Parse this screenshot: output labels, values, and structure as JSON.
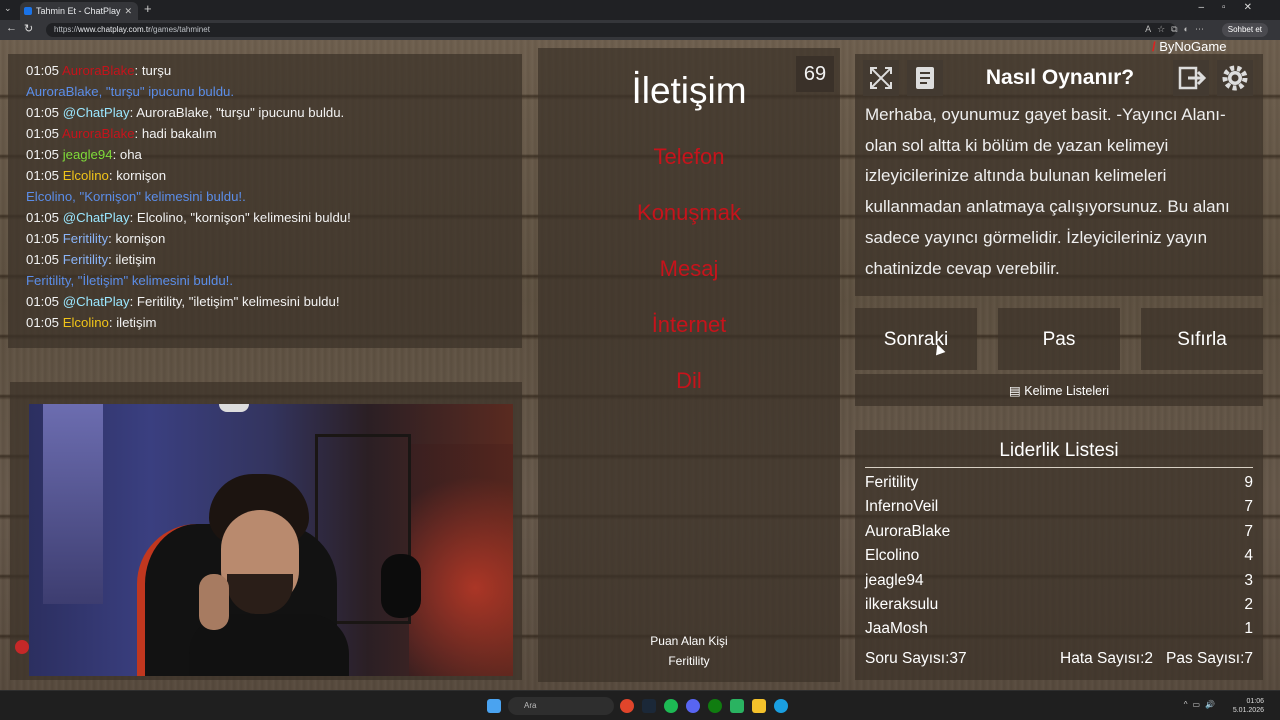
{
  "browser": {
    "tab_title": "Tahmin Et - ChatPlay",
    "url_prefix": "https://",
    "url_host": "www.chatplay.com.tr",
    "url_path": "/games/tahminet",
    "chat_button": "Sohbet et"
  },
  "chat": [
    {
      "ts": "01:05",
      "user": "AuroraBlake",
      "user_color": "#c6131b",
      "text": ": turşu"
    },
    {
      "system": "AuroraBlake, \"turşu\" ipucunu buldu."
    },
    {
      "ts": "01:05",
      "user": "@ChatPlay",
      "user_color": "#9be7ff",
      "text": ": AuroraBlake, \"turşu\" ipucunu buldu."
    },
    {
      "ts": "01:05",
      "user": "AuroraBlake",
      "user_color": "#c6131b",
      "text": ": hadi bakalım"
    },
    {
      "ts": "01:05",
      "user": "jeagle94",
      "user_color": "#7fdc3a",
      "text": ": oha"
    },
    {
      "ts": "01:05",
      "user": "Elcolino",
      "user_color": "#f0c419",
      "text": ": kornişon"
    },
    {
      "system": "Elcolino, \"Kornişon\" kelimesini buldu!."
    },
    {
      "ts": "01:05",
      "user": "@ChatPlay",
      "user_color": "#9be7ff",
      "text": ": Elcolino, \"kornişon\" kelimesini buldu!"
    },
    {
      "ts": "01:05",
      "user": "Feritility",
      "user_color": "#8ab4f8",
      "text": ": kornişon"
    },
    {
      "ts": "01:05",
      "user": "Feritility",
      "user_color": "#8ab4f8",
      "text": ": iletişim"
    },
    {
      "system": "Feritility, \"İletişim\" kelimesini buldu!."
    },
    {
      "ts": "01:05",
      "user": "@ChatPlay",
      "user_color": "#9be7ff",
      "text": ": Feritility, \"iletişim\" kelimesini buldu!"
    },
    {
      "ts": "01:05",
      "user": "Elcolino",
      "user_color": "#f0c419",
      "text": ": iletişim"
    }
  ],
  "card": {
    "timer": "69",
    "word": "İletişim",
    "forbidden": [
      "Telefon",
      "Konuşmak",
      "Mesaj",
      "İnternet",
      "Dil"
    ],
    "scorer_label": "Puan Alan Kişi",
    "scorer_name": "Feritility"
  },
  "howto": {
    "title": "Nasıl Oynanır?",
    "text": "Merhaba, oyunumuz gayet basit. -Yayıncı Alanı- olan sol altta ki bölüm de yazan kelimeyi izleyicilerinize altında bulunan kelimeleri kullanmadan anlatmaya çalışıyorsunuz. Bu alanı sadece yayıncı görmelidir. İzleyicileriniz yayın chatinizde cevap verebilir.",
    "logo": "ByNoGame"
  },
  "controls": {
    "next": "Sonraki",
    "pass": "Pas",
    "reset": "Sıfırla",
    "word_lists": "Kelime Listeleri"
  },
  "leaderboard": {
    "title": "Liderlik Listesi",
    "rows": [
      {
        "name": "Feritility",
        "score": "9"
      },
      {
        "name": "InfernoVeil",
        "score": "7"
      },
      {
        "name": "AuroraBlake",
        "score": "7"
      },
      {
        "name": "Elcolino",
        "score": "4"
      },
      {
        "name": "jeagle94",
        "score": "3"
      },
      {
        "name": "ilkeraksulu",
        "score": "2"
      },
      {
        "name": "JaaMosh",
        "score": "1"
      }
    ],
    "question_count": "Soru Sayısı:37",
    "error_count": "Hata Sayısı:2",
    "pass_count": "Pas Sayısı:7"
  },
  "taskbar": {
    "search_placeholder": "Ara",
    "time": "01:06",
    "date": "5.01.2026"
  }
}
